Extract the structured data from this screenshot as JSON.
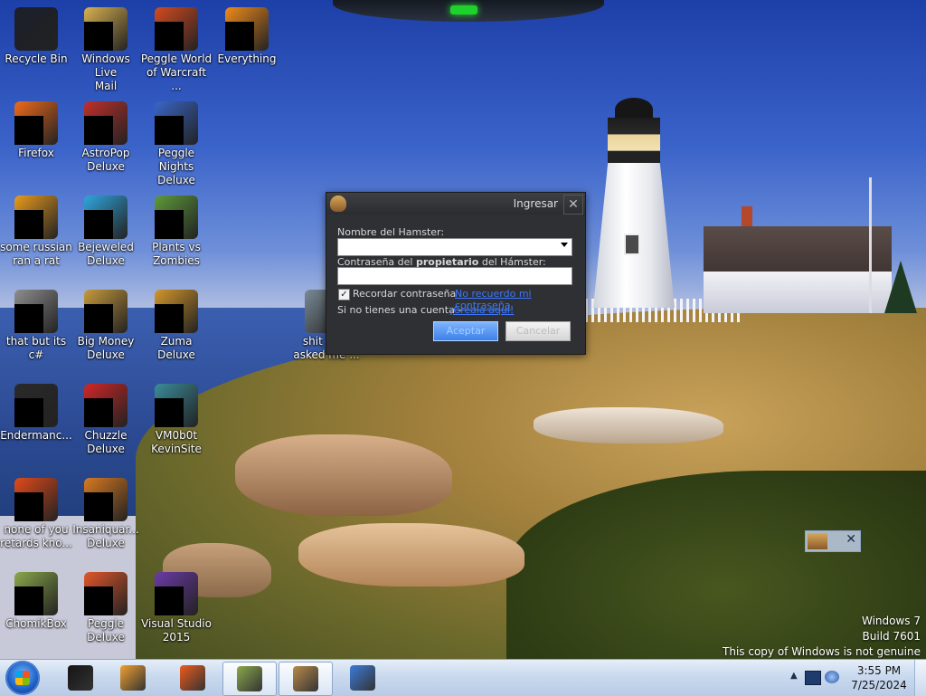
{
  "desktop": {
    "icons": [
      {
        "label": "Recycle Bin",
        "masked": false,
        "art": "#1a1f2a"
      },
      {
        "label": "Windows Live\nMail",
        "masked": true,
        "art": "#d9b24f"
      },
      {
        "label": "Peggle World\nof Warcraft ...",
        "masked": true,
        "art": "#d44a1f"
      },
      {
        "label": "Everything",
        "masked": true,
        "art": "#f08a1a"
      },
      {
        "label": "Firefox",
        "masked": true,
        "art": "#f06a1a"
      },
      {
        "label": "AstroPop\nDeluxe",
        "masked": true,
        "art": "#c0302a"
      },
      {
        "label": "Peggle Nights\nDeluxe",
        "masked": true,
        "art": "#3a66c8"
      },
      {
        "label": "some russian\nran a rat",
        "masked": true,
        "art": "#e89b1c"
      },
      {
        "label": "Bejeweled\nDeluxe",
        "masked": true,
        "art": "#2fa6de"
      },
      {
        "label": "Plants vs\nZombies",
        "masked": true,
        "art": "#5e9a3a"
      },
      {
        "label": "that but its c#",
        "masked": true,
        "art": "#8e8e8e"
      },
      {
        "label": "Big Money\nDeluxe",
        "masked": true,
        "art": "#c79a3b"
      },
      {
        "label": "Zuma Deluxe",
        "masked": true,
        "art": "#d3962a"
      },
      {
        "label": "shit pe...\nasked me ...",
        "masked": false,
        "art": "#7a8a96"
      },
      {
        "label": "Endermanc...",
        "masked": true,
        "art": "#2a2a2a"
      },
      {
        "label": "Chuzzle\nDeluxe",
        "masked": true,
        "art": "#d02626"
      },
      {
        "label": "VM0b0t\nKevinSite",
        "masked": true,
        "art": "#3b8c9a"
      },
      {
        "label": "none of you\nretards kno...",
        "masked": true,
        "art": "#e24a1a"
      },
      {
        "label": "Insaniquar...\nDeluxe",
        "masked": true,
        "art": "#d97a20"
      },
      {
        "label": "ChomikBox",
        "masked": true,
        "art": "#8aa84a"
      },
      {
        "label": "Peggle Deluxe",
        "masked": true,
        "art": "#e2572a"
      },
      {
        "label": "Visual Studio\n2015",
        "masked": true,
        "art": "#6c3aa8"
      }
    ]
  },
  "dialog": {
    "title": "Ingresar",
    "close_glyph": "✕",
    "name_label": "Nombre del Hamster:",
    "name_value": "",
    "password_label_pre": "Contraseña del ",
    "password_label_bold": "propietario",
    "password_label_post": " del Hámster:",
    "password_value": "",
    "remember_label": "Recordar contraseña",
    "remember_checked": "✓",
    "forgot_link": "No recuerdo mi contraseña",
    "no_account_text": "Si no tienes una cuenta -",
    "create_link": "¡Créala aquí!",
    "accept_button": "Aceptar",
    "cancel_button": "Cancelar"
  },
  "widget": {
    "close_glyph": "✕"
  },
  "watermark": {
    "line1": "Windows 7",
    "line2": "Build 7601",
    "line3": "This copy of Windows is not genuine"
  },
  "taskbar": {
    "buttons": [
      {
        "name": "taskbar-item-1",
        "art": "#141414",
        "active": false
      },
      {
        "name": "taskbar-item-2",
        "art": "#f0a030",
        "active": false
      },
      {
        "name": "taskbar-firefox",
        "art": "#ee5a1a",
        "active": false
      },
      {
        "name": "taskbar-chomikbox",
        "art": "#8aa84a",
        "active": true
      },
      {
        "name": "taskbar-hamster",
        "art": "#b88a4a",
        "active": true
      },
      {
        "name": "taskbar-item-6",
        "art": "#3b7bd8",
        "active": false
      }
    ],
    "tray_up_glyph": "▲",
    "time": "3:55 PM",
    "date": "7/25/2024"
  }
}
